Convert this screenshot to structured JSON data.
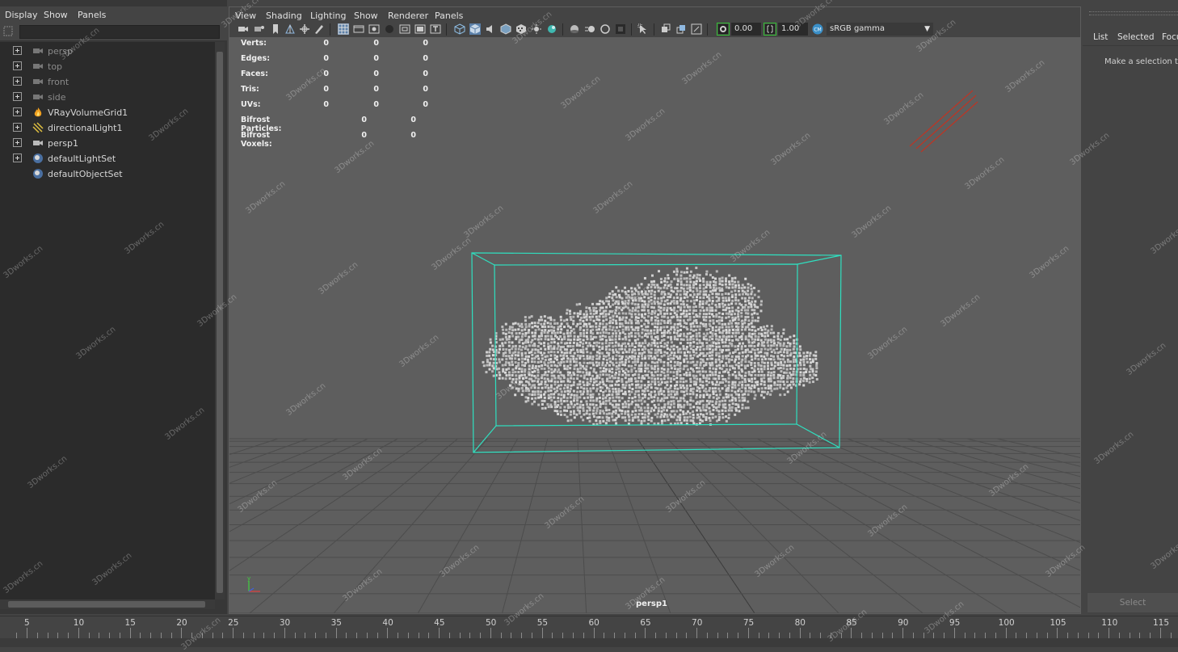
{
  "outliner": {
    "menu": [
      "Display",
      "Show",
      "Panels"
    ],
    "items": [
      {
        "label": "persp",
        "icon": "camera-icon",
        "dimmed": true
      },
      {
        "label": "top",
        "icon": "camera-icon",
        "dimmed": true
      },
      {
        "label": "front",
        "icon": "camera-icon",
        "dimmed": true
      },
      {
        "label": "side",
        "icon": "camera-icon",
        "dimmed": true
      },
      {
        "label": "VRayVolumeGrid1",
        "icon": "fire-icon",
        "dimmed": false
      },
      {
        "label": "directionalLight1",
        "icon": "directional-light-icon",
        "dimmed": false
      },
      {
        "label": "persp1",
        "icon": "camera-icon",
        "dimmed": false
      },
      {
        "label": "defaultLightSet",
        "icon": "set-icon",
        "dimmed": false
      },
      {
        "label": "defaultObjectSet",
        "icon": "set-icon",
        "dimmed": false
      }
    ]
  },
  "viewport": {
    "menu": [
      "View",
      "Shading",
      "Lighting",
      "Show",
      "Renderer",
      "Panels"
    ],
    "exposure": "0.00",
    "gamma": "1.00",
    "colorspace": "sRGB gamma",
    "camera_name": "persp1",
    "hud": [
      {
        "label": "Verts:",
        "values": [
          "0",
          "0",
          "0"
        ]
      },
      {
        "label": "Edges:",
        "values": [
          "0",
          "0",
          "0"
        ]
      },
      {
        "label": "Faces:",
        "values": [
          "0",
          "0",
          "0"
        ]
      },
      {
        "label": "Tris:",
        "values": [
          "0",
          "0",
          "0"
        ]
      },
      {
        "label": "UVs:",
        "values": [
          "0",
          "0",
          "0"
        ]
      },
      {
        "label": "Bifrost Particles:",
        "values": [
          "0",
          "0"
        ]
      },
      {
        "label": "Bifrost Voxels:",
        "values": [
          "0",
          "0"
        ]
      }
    ],
    "colors": {
      "bounding_box": "#2fe0c0",
      "light_arrows": "#c8301e",
      "cloud": "#c8c8c8"
    }
  },
  "right_panel": {
    "tabs": [
      "List",
      "Selected",
      "Focu"
    ],
    "message": "Make a selection to",
    "select_button": "Select"
  },
  "timeslider": {
    "ticks": [
      "5",
      "10",
      "15",
      "20",
      "25",
      "30",
      "35",
      "40",
      "45",
      "50",
      "55",
      "60",
      "65",
      "70",
      "75",
      "80",
      "85",
      "90",
      "95",
      "100",
      "105",
      "110",
      "115"
    ]
  },
  "watermark": "3Dworks.cn"
}
